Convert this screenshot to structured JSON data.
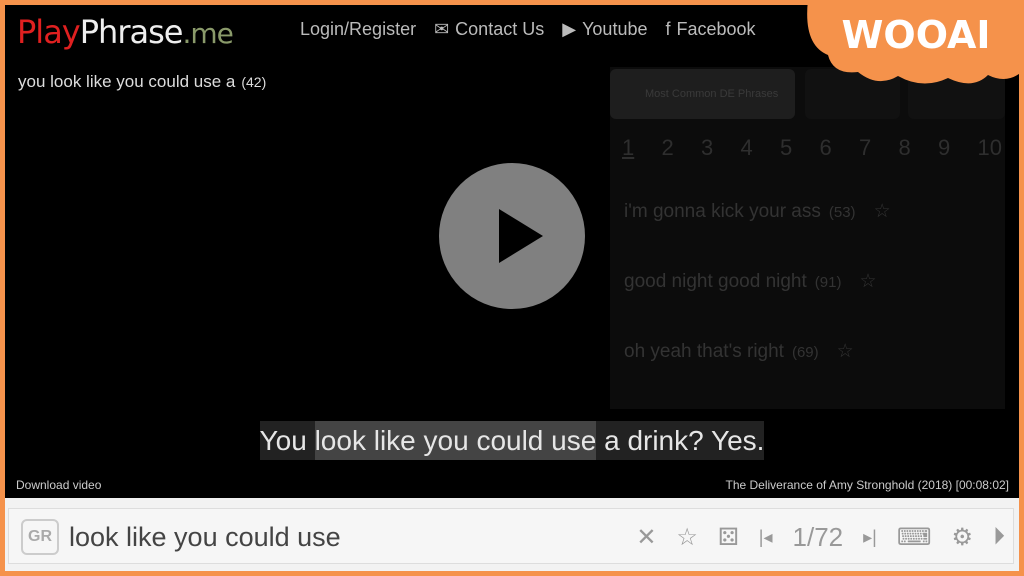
{
  "header": {
    "logo": {
      "play": "Play",
      "phrase": "Phrase",
      ".me": ".me"
    },
    "nav": [
      {
        "icon": "envelope-icon",
        "label": "Login/Register"
      },
      {
        "icon": "envelope-icon",
        "label": "Contact Us"
      },
      {
        "icon": "youtube-icon",
        "label": "Youtube"
      },
      {
        "icon": "facebook-icon",
        "label": "Facebook"
      }
    ]
  },
  "phrase": {
    "text": "you look like you could use a",
    "count": "(42)"
  },
  "panel": {
    "tab": "Most Common DE Phrases",
    "pages": [
      "1",
      "2",
      "3",
      "4",
      "5",
      "6",
      "7",
      "8",
      "9",
      "10"
    ],
    "items": [
      {
        "text": "i'm gonna kick your ass",
        "count": "(53)"
      },
      {
        "text": "good night good night",
        "count": "(91)"
      },
      {
        "text": "oh yeah that's right",
        "count": "(69)"
      }
    ]
  },
  "subtitle": {
    "before": "You ",
    "highlight": "look like you could use",
    "after": " a drink? Yes."
  },
  "footer": {
    "download": "Download video",
    "source": "The Deliverance of Amy Stronghold (2018) [00:08:02]"
  },
  "search": {
    "lang": "GR",
    "query": "look like you could use",
    "counter": "1/72"
  },
  "watermark": "WOOAI",
  "colors": {
    "frame": "#f5924b",
    "logo_red": "#e02020"
  }
}
